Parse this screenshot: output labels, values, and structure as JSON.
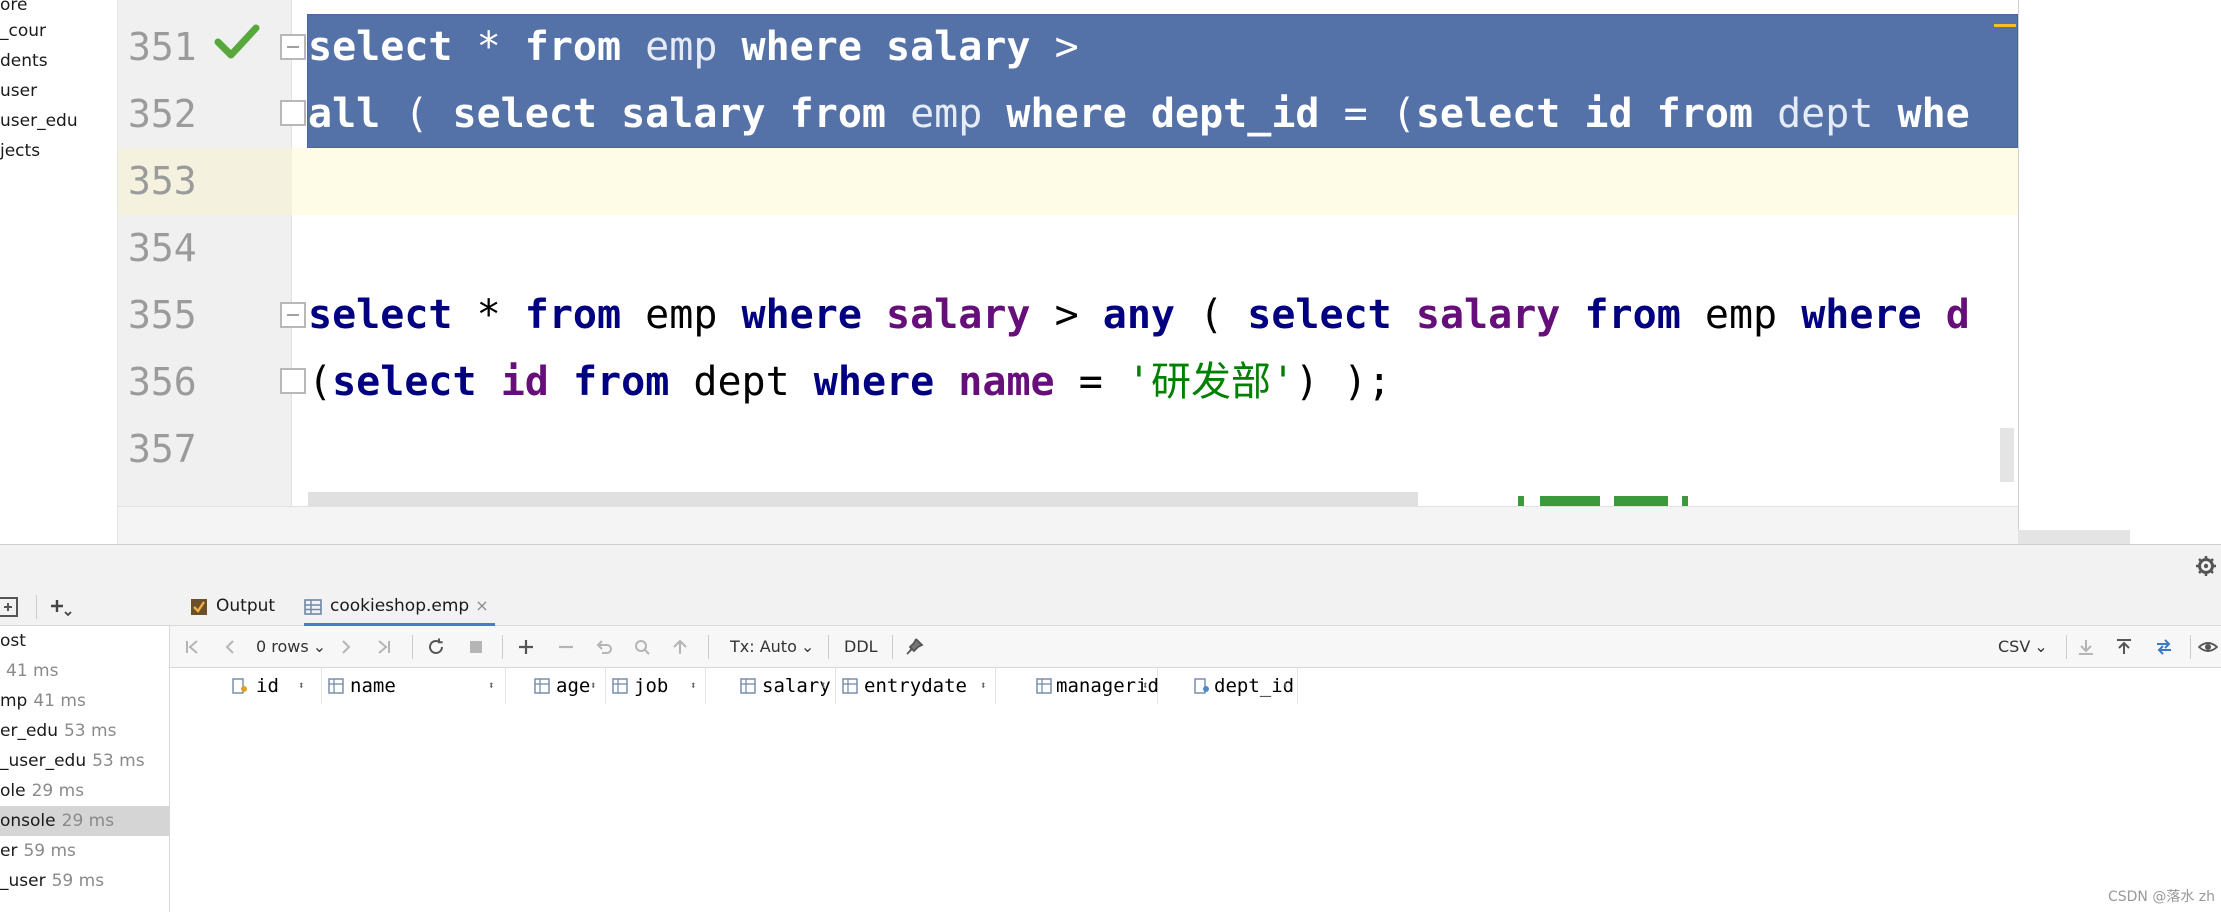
{
  "project_tree": {
    "items": [
      "ore",
      "_cour",
      "dents",
      "user",
      "user_edu",
      "jects"
    ]
  },
  "editor": {
    "line_numbers": [
      "351",
      "352",
      "353",
      "354",
      "355",
      "356",
      "357"
    ],
    "line_351": {
      "t1": "select",
      "t2": " * ",
      "t3": "from",
      "t4": " emp ",
      "t5": "where",
      "t6": " salary ",
      "t7": ">"
    },
    "line_352": {
      "t1": "all",
      "t2": " ( ",
      "t3": "select",
      "t4": " salary ",
      "t5": "from",
      "t6": " emp ",
      "t7": "where",
      "t8": " dept_id ",
      "t9": "= (",
      "t10": "select",
      "t11": " id ",
      "t12": "from",
      "t13": " dept ",
      "t14": "whe"
    },
    "line_355": {
      "t1": "select",
      "t2": " * ",
      "t3": "from",
      "t4": " emp ",
      "t5": "where",
      "t6": " ",
      "t7": "salary",
      "t8": " > ",
      "t9": "any",
      "t10": " ( ",
      "t11": "select",
      "t12": " ",
      "t13": "salary",
      "t14": " ",
      "t15": "from",
      "t16": " emp ",
      "t17": "where",
      "t18": " d"
    },
    "line_356": {
      "t1": "(",
      "t2": "select",
      "t3": " ",
      "t4": "id",
      "t5": " ",
      "t6": "from",
      "t7": " dept ",
      "t8": "where",
      "t9": " ",
      "t10": "name",
      "t11": " = ",
      "t12": "'研发部'",
      "t13": ") );"
    }
  },
  "services": {
    "sessions": [
      {
        "name": "ost",
        "ms": ""
      },
      {
        "name": "",
        "ms": "41 ms"
      },
      {
        "name": "mp",
        "ms": "41 ms"
      },
      {
        "name": "er_edu",
        "ms": "53 ms"
      },
      {
        "name": "_user_edu",
        "ms": "53 ms"
      },
      {
        "name": "ole",
        "ms": "29 ms"
      },
      {
        "name": "onsole",
        "ms": "29 ms"
      },
      {
        "name": "er",
        "ms": "59 ms"
      },
      {
        "name": "_user",
        "ms": "59 ms"
      }
    ],
    "active_session_index": 6,
    "tabs": [
      {
        "label": "Output"
      },
      {
        "label": "cookieshop.emp",
        "close": "×"
      }
    ],
    "toolbar": {
      "rows": "0 rows",
      "tx": "Tx: Auto",
      "ddl": "DDL",
      "export": "CSV"
    },
    "columns": [
      "id",
      "name",
      "age",
      "job",
      "salary",
      "entrydate",
      "managerid",
      "dept_id"
    ]
  },
  "watermark": "CSDN @落水 zh"
}
